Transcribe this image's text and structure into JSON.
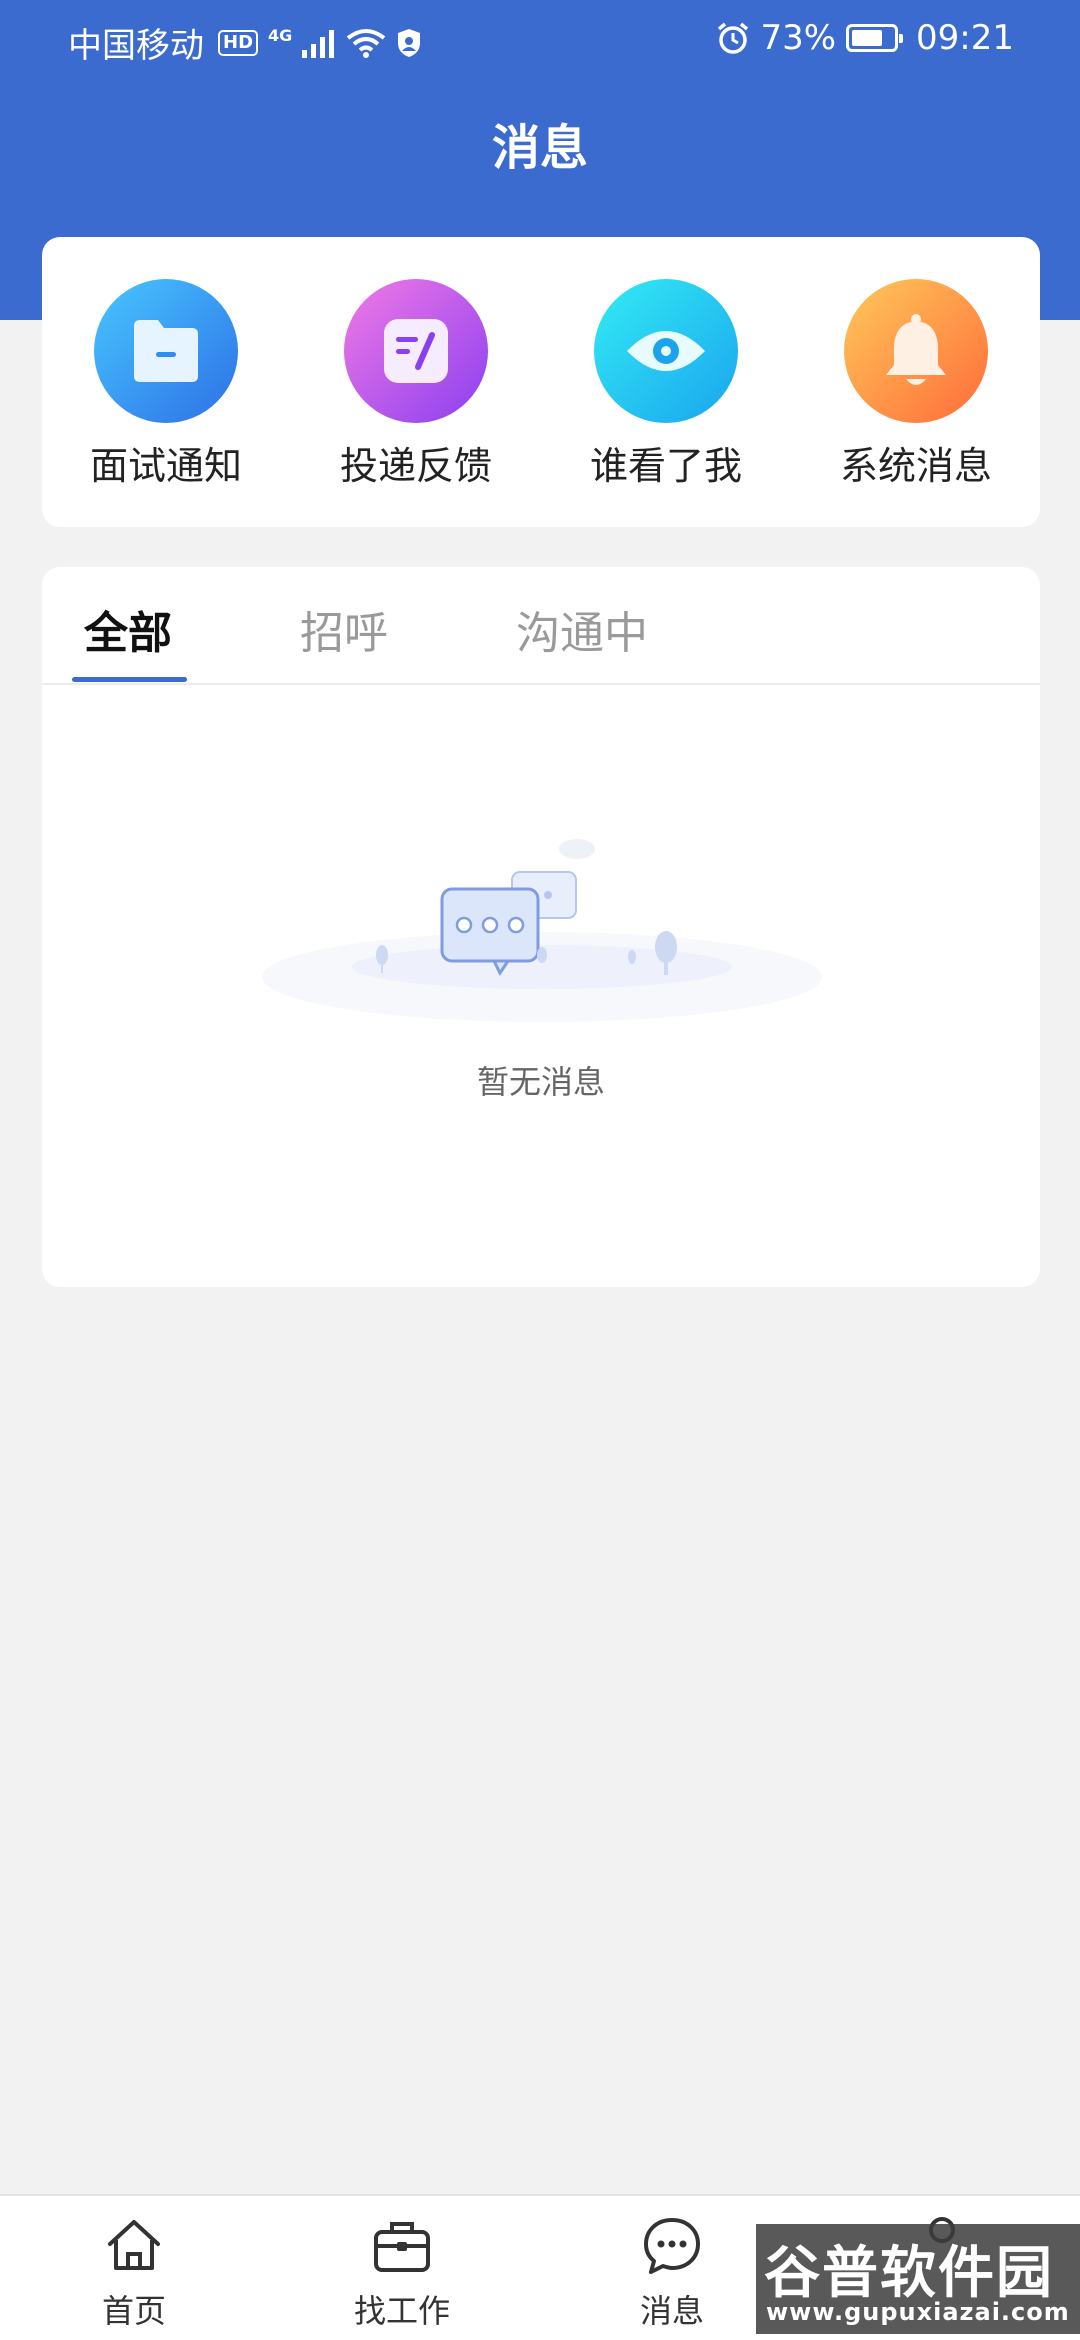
{
  "status_bar": {
    "carrier": "中国移动",
    "hd": "HD",
    "network": "4G",
    "battery": "73%",
    "time": "09:21"
  },
  "header": {
    "title": "消息"
  },
  "shortcuts": [
    {
      "label": "面试通知",
      "icon": "folder-icon"
    },
    {
      "label": "投递反馈",
      "icon": "edit-note-icon"
    },
    {
      "label": "谁看了我",
      "icon": "eye-icon"
    },
    {
      "label": "系统消息",
      "icon": "bell-icon"
    }
  ],
  "message_tabs": {
    "items": [
      "全部",
      "招呼",
      "沟通中"
    ],
    "active_index": 0
  },
  "empty_state": {
    "text": "暂无消息",
    "icon": "chat-bubbles-icon"
  },
  "bottom_nav": [
    {
      "label": "首页",
      "icon": "home-icon"
    },
    {
      "label": "找工作",
      "icon": "briefcase-icon"
    },
    {
      "label": "消息",
      "icon": "chat-icon"
    }
  ],
  "watermark": {
    "name": "谷普软件园",
    "url": "www.gupuxiazai.com"
  },
  "colors": {
    "primary": "#3c6bd0",
    "background": "#f2f2f2"
  }
}
